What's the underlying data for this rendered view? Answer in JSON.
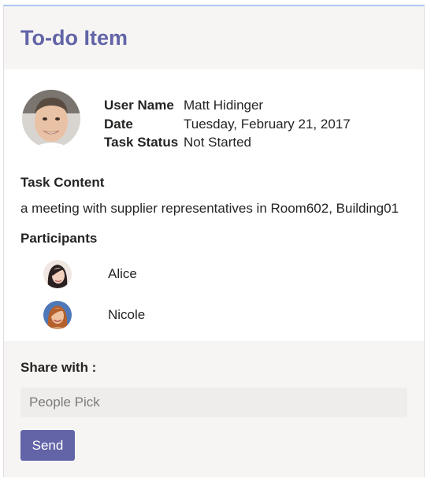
{
  "card": {
    "title": "To-do Item"
  },
  "user": {
    "avatar_icon": "user-avatar-photo",
    "facts": [
      {
        "key": "User Name",
        "value": "Matt Hidinger"
      },
      {
        "key": "Date",
        "value": "Tuesday, February 21, 2017"
      },
      {
        "key": "Task Status",
        "value": "Not Started"
      }
    ]
  },
  "task": {
    "content_label": "Task Content",
    "content": "a meeting with supplier representatives in Room602, Building01",
    "participants_label": "Participants",
    "participants": [
      {
        "name": "Alice",
        "avatar_icon": "participant-avatar-photo"
      },
      {
        "name": "Nicole",
        "avatar_icon": "participant-avatar-photo"
      }
    ]
  },
  "share": {
    "label": "Share with :",
    "input_placeholder": "People Pick",
    "input_value": "",
    "send_label": "Send"
  },
  "colors": {
    "accent": "#6264a7",
    "header_bg": "#f7f5f4",
    "input_bg": "#efedeb",
    "top_border": "#a9c7ef"
  }
}
